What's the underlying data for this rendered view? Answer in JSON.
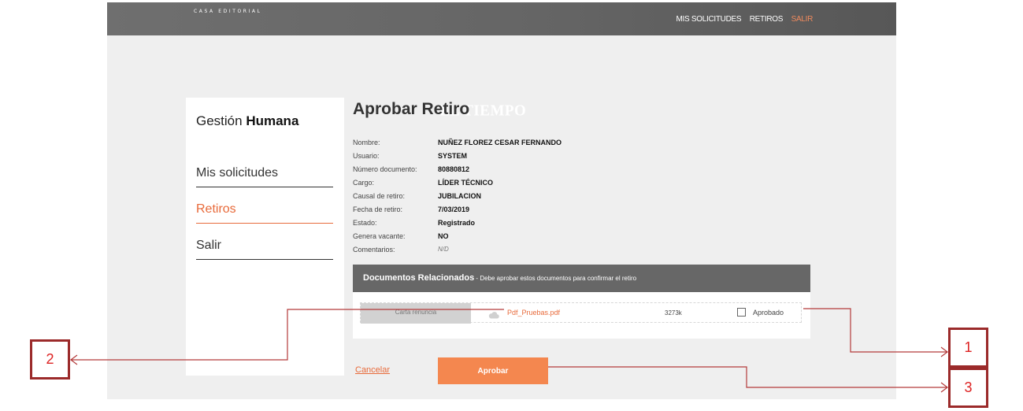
{
  "header": {
    "logo_main": "EL TIEMPO",
    "logo_sub": "CASA EDITORIAL",
    "nav": [
      "MIS SOLICITUDES",
      "RETIROS"
    ],
    "exit_label": "SALIR"
  },
  "sidebar": {
    "title_light": "Gestión",
    "title_bold": "Humana",
    "items": [
      {
        "label": "Mis solicitudes"
      },
      {
        "label": "Retiros"
      },
      {
        "label": "Salir"
      }
    ]
  },
  "page": {
    "title": "Aprobar Retiro",
    "fields": [
      {
        "label": "Nombre:",
        "value": "NUÑEZ FLOREZ CESAR FERNANDO"
      },
      {
        "label": "Usuario:",
        "value": "SYSTEM"
      },
      {
        "label": "Número documento:",
        "value": "80880812"
      },
      {
        "label": "Cargo:",
        "value": "LÍDER TÉCNICO"
      },
      {
        "label": "Causal de retiro:",
        "value": "JUBILACION"
      },
      {
        "label": "Fecha de retiro:",
        "value": "7/03/2019"
      },
      {
        "label": "Estado:",
        "value": "Registrado"
      },
      {
        "label": "Genera vacante:",
        "value": "NO"
      },
      {
        "label": "Comentarios:",
        "value": "N/D"
      }
    ]
  },
  "documents": {
    "heading": "Documentos Relacionados",
    "subheading": " - Debe aprobar estos documentos para confirmar el retiro",
    "rows": [
      {
        "type": "Carta renuncia",
        "file": "Pdf_Pruebas.pdf",
        "size": "3273k",
        "check_label": "Aprobado",
        "checked": false
      }
    ]
  },
  "actions": {
    "cancel": "Cancelar",
    "approve": "Aprobar"
  },
  "annotations": {
    "labels": [
      "1",
      "2",
      "3"
    ],
    "color": "#d22222"
  },
  "colors": {
    "accent": "#e86a3a",
    "topbar": "#666666",
    "docs_header": "#676767"
  }
}
